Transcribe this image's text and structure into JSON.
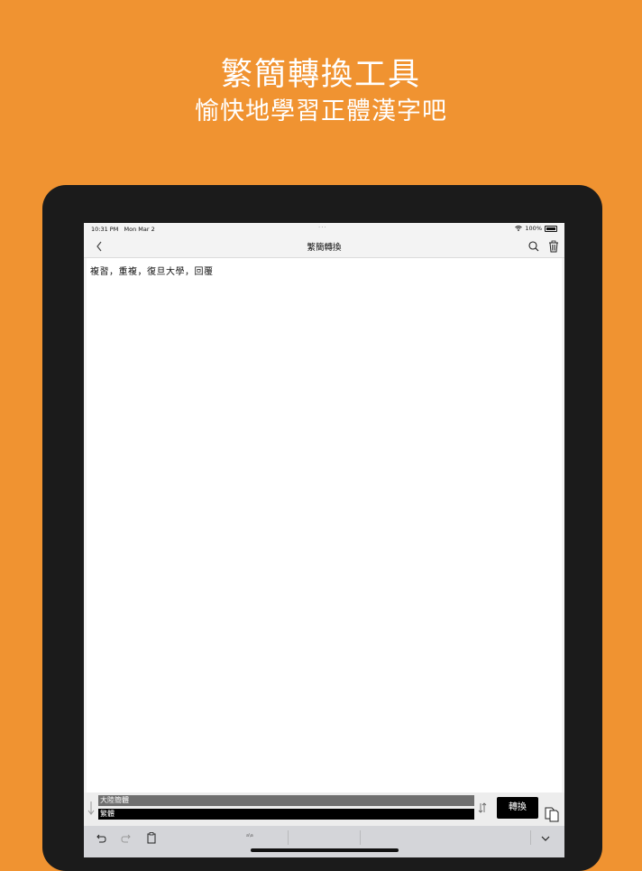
{
  "promo": {
    "title": "繁簡轉換工具",
    "subtitle": "愉快地學習正體漢字吧"
  },
  "status_bar": {
    "time": "10:31 PM",
    "date": "Mon Mar 2",
    "battery": "100%"
  },
  "nav": {
    "title": "繁簡轉換",
    "back_icon": "chevron-left-icon",
    "search_icon": "search-icon",
    "trash_icon": "trash-icon"
  },
  "editor": {
    "text": "複習，重複，復旦大學，回覆"
  },
  "converter": {
    "source": "大陸簡體",
    "target": "繁體",
    "convert_label": "轉換"
  },
  "keyboard_bar": {
    "middle_label": "a\\a"
  },
  "colors": {
    "background": "#F09331",
    "device": "#1B1B1B",
    "source_field": "#6F6F6F",
    "target_field": "#000000"
  }
}
